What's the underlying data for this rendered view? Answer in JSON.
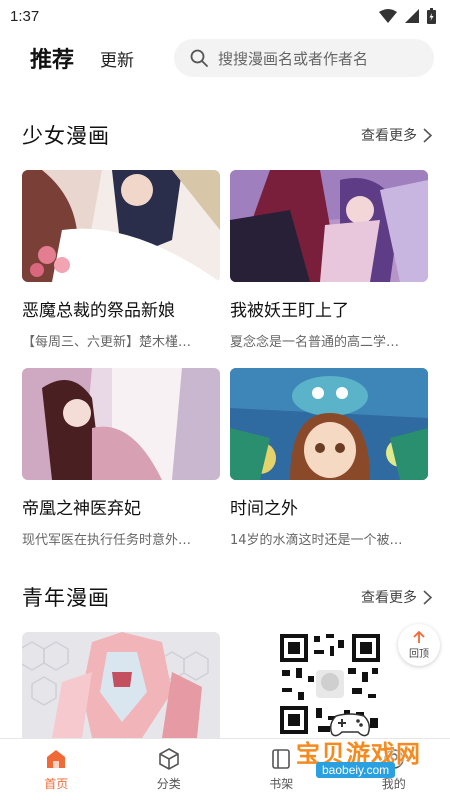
{
  "status": {
    "time": "1:37"
  },
  "header": {
    "tab_recommend": "推荐",
    "tab_update": "更新",
    "search_placeholder": "搜搜漫画名或者作者名"
  },
  "sections": [
    {
      "title": "少女漫画",
      "more": "查看更多",
      "cards": [
        {
          "title": "恶魔总裁的祭品新娘",
          "desc": "【每周三、六更新】楚木槿…"
        },
        {
          "title": "我被妖王盯上了",
          "desc": "夏念念是一名普通的高二学…"
        },
        {
          "title": "帝凰之神医弃妃",
          "desc": "现代军医在执行任务时意外…"
        },
        {
          "title": "时间之外",
          "desc": "14岁的水滴这时还是一个被…"
        }
      ]
    },
    {
      "title": "青年漫画",
      "more": "查看更多"
    }
  ],
  "float_button": {
    "label": "回顶"
  },
  "watermark": {
    "text": "宝贝游戏网",
    "url": "baobeiy.com"
  },
  "bottom_nav": [
    {
      "label": "首页",
      "icon": "home-icon",
      "active": true
    },
    {
      "label": "分类",
      "icon": "cube-icon",
      "active": false
    },
    {
      "label": "书架",
      "icon": "bookshelf-icon",
      "active": false
    },
    {
      "label": "我的",
      "icon": "profile-icon",
      "active": false
    }
  ],
  "colors": {
    "accent": "#f06a37",
    "watermark": "#f58a1f"
  }
}
